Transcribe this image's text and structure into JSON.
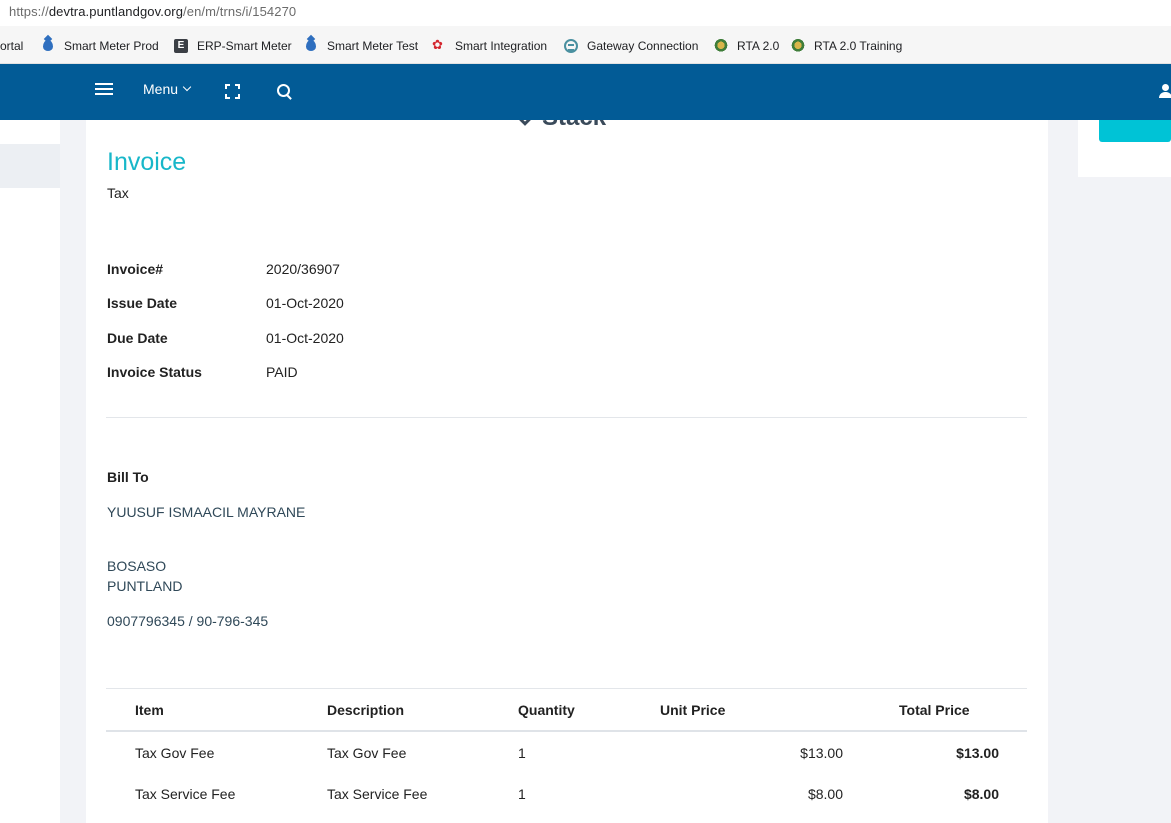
{
  "browser": {
    "url_prefix": "https://",
    "url_host": "devtra.puntlandgov.org",
    "url_path": "/en/m/trns/i/154270",
    "bookmarks": [
      {
        "label": "ortal",
        "icon": "none"
      },
      {
        "label": "Smart Meter Prod",
        "icon": "water-drop-icon"
      },
      {
        "label": "ERP-Smart Meter",
        "icon": "e-letter-icon"
      },
      {
        "label": "Smart Meter Test",
        "icon": "water-drop-icon"
      },
      {
        "label": "Smart Integration",
        "icon": "huawei-icon"
      },
      {
        "label": "Gateway Connection",
        "icon": "gateway-icon"
      },
      {
        "label": "RTA 2.0",
        "icon": "crest-icon"
      },
      {
        "label": "RTA 2.0 Training",
        "icon": "crest-icon"
      }
    ]
  },
  "appbar": {
    "menu_label": "Menu",
    "bg_color": "#025b96"
  },
  "invoice": {
    "logo_text": "Stack",
    "title": "Invoice",
    "subtitle": "Tax",
    "meta": [
      {
        "label": "Invoice#",
        "value": "2020/36907"
      },
      {
        "label": "Issue Date",
        "value": "01-Oct-2020"
      },
      {
        "label": "Due Date",
        "value": "01-Oct-2020"
      },
      {
        "label": "Invoice Status",
        "value": "PAID"
      }
    ],
    "bill_to": {
      "label": "Bill To",
      "name": "YUUSUF ISMAACIL MAYRANE",
      "city": "BOSASO",
      "region": "PUNTLAND",
      "phone": "0907796345 / 90-796-345"
    },
    "table": {
      "headers": [
        "Item",
        "Description",
        "Quantity",
        "Unit Price",
        "Total Price"
      ],
      "rows": [
        {
          "item": "Tax Gov Fee",
          "description": "Tax Gov Fee",
          "quantity": "1",
          "unit_price": "$13.00",
          "total_price": "$13.00"
        },
        {
          "item": "Tax Service Fee",
          "description": "Tax Service Fee",
          "quantity": "1",
          "unit_price": "$8.00",
          "total_price": "$8.00"
        }
      ]
    },
    "accent_color": "#18b7c9"
  }
}
